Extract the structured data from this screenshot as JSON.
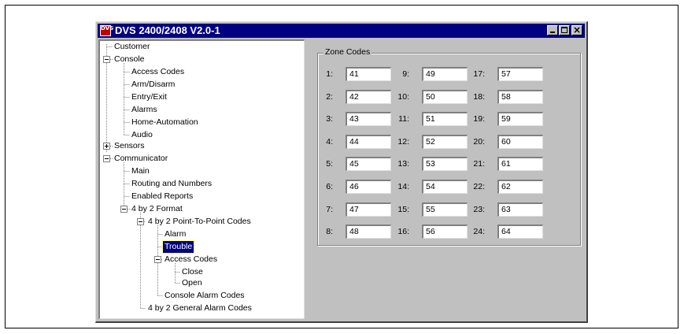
{
  "window": {
    "title": "DVS 2400/2408 V2.0-1",
    "icon_text": "DVS"
  },
  "tree": {
    "items": [
      {
        "label": "Customer"
      },
      {
        "label": "Console"
      },
      {
        "label": "Access Codes"
      },
      {
        "label": "Arm/Disarm"
      },
      {
        "label": "Entry/Exit"
      },
      {
        "label": "Alarms"
      },
      {
        "label": "Home-Automation"
      },
      {
        "label": "Audio"
      },
      {
        "label": "Sensors"
      },
      {
        "label": "Communicator"
      },
      {
        "label": "Main"
      },
      {
        "label": "Routing and Numbers"
      },
      {
        "label": "Enabled Reports"
      },
      {
        "label": "4 by 2 Format"
      },
      {
        "label": "4 by 2 Point-To-Point Codes"
      },
      {
        "label": "Alarm"
      },
      {
        "label": "Trouble",
        "selected": true
      },
      {
        "label": "Access Codes"
      },
      {
        "label": "Close"
      },
      {
        "label": "Open"
      },
      {
        "label": "Console Alarm Codes"
      },
      {
        "label": "4 by 2 General Alarm Codes"
      }
    ]
  },
  "zone_codes": {
    "title": "Zone Codes",
    "zones": [
      {
        "label": "1:",
        "value": "41"
      },
      {
        "label": "2:",
        "value": "42"
      },
      {
        "label": "3:",
        "value": "43"
      },
      {
        "label": "4:",
        "value": "44"
      },
      {
        "label": "5:",
        "value": "45"
      },
      {
        "label": "6:",
        "value": "46"
      },
      {
        "label": "7:",
        "value": "47"
      },
      {
        "label": "8:",
        "value": "48"
      },
      {
        "label": "9:",
        "value": "49"
      },
      {
        "label": "10:",
        "value": "50"
      },
      {
        "label": "11:",
        "value": "51"
      },
      {
        "label": "12:",
        "value": "52"
      },
      {
        "label": "13:",
        "value": "53"
      },
      {
        "label": "14:",
        "value": "54"
      },
      {
        "label": "15:",
        "value": "55"
      },
      {
        "label": "16:",
        "value": "56"
      },
      {
        "label": "17:",
        "value": "57"
      },
      {
        "label": "18:",
        "value": "58"
      },
      {
        "label": "19:",
        "value": "59"
      },
      {
        "label": "20:",
        "value": "60"
      },
      {
        "label": "21:",
        "value": "61"
      },
      {
        "label": "22:",
        "value": "62"
      },
      {
        "label": "23:",
        "value": "63"
      },
      {
        "label": "24:",
        "value": "64"
      }
    ]
  }
}
